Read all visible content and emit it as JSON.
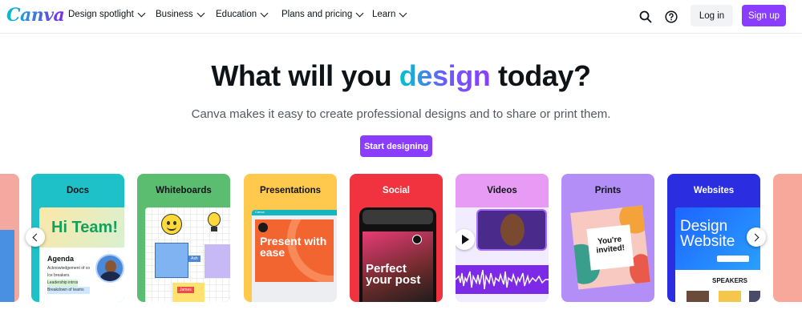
{
  "nav": {
    "logo": "Canva",
    "menu": [
      {
        "label": "Design spotlight"
      },
      {
        "label": "Business"
      },
      {
        "label": "Education"
      },
      {
        "label": "Plans and pricing"
      },
      {
        "label": "Learn"
      }
    ],
    "login_label": "Log in",
    "signup_label": "Sign up"
  },
  "hero": {
    "headline_pre": "What will you",
    "headline_accent": "design",
    "headline_post": "today?",
    "subtitle": "Canva makes it easy to create professional designs and to share or print them.",
    "cta_label": "Start designing"
  },
  "cards": [
    {
      "label": "Docs",
      "bg": "#1fc1c9"
    },
    {
      "label": "Whiteboards",
      "bg": "#5bbd70"
    },
    {
      "label": "Presentations",
      "bg": "#ffc94d"
    },
    {
      "label": "Social",
      "bg": "#f0333f"
    },
    {
      "label": "Videos",
      "bg": "#e79bf4"
    },
    {
      "label": "Prints",
      "bg": "#b48ef7"
    },
    {
      "label": "Websites",
      "bg": "#2b2ee0"
    }
  ],
  "card_content": {
    "docs_heading": "Hi Team!",
    "docs_agenda": "Agenda",
    "docs_items": [
      "Acknowledgement of co",
      "Ice breakers",
      "Leadership intros",
      "Breakdown of teams"
    ],
    "wb_tag1": "Ash",
    "wb_tag2": "James",
    "pres_text": "Present with ease",
    "pres_brand": "Canva",
    "social_text": "Perfect your post",
    "prints_text": "You're invited!",
    "web_text": "Design Website",
    "web_speakers": "SPEAKERS"
  },
  "colors": {
    "accent": "#8b3dff",
    "teal": "#00c4cc"
  }
}
